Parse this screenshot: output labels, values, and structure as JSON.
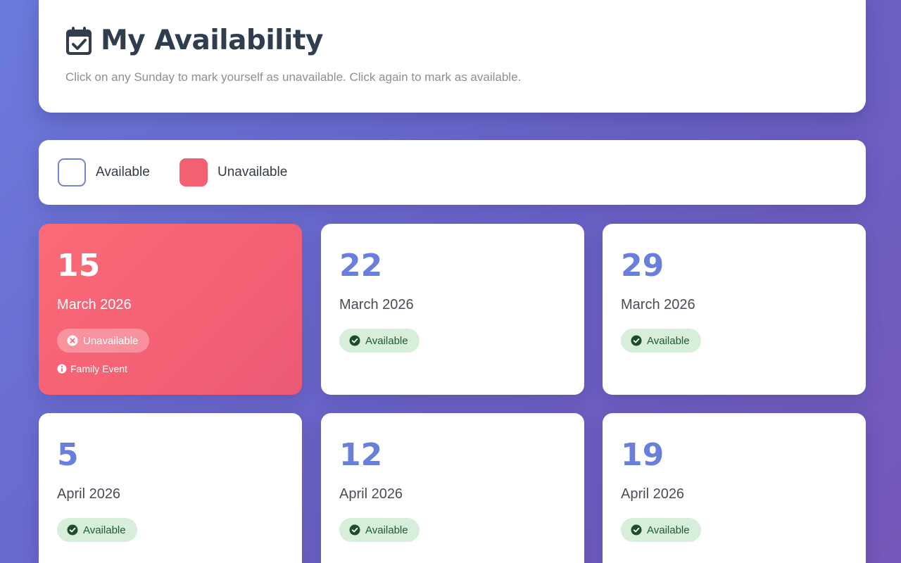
{
  "header": {
    "title": "My Availability",
    "icon": "calendar-check-icon",
    "subtitle": "Click on any Sunday to mark yourself as unavailable. Click again to mark as available."
  },
  "legend": {
    "available_label": "Available",
    "unavailable_label": "Unavailable"
  },
  "colors": {
    "unavailable": "#f26172",
    "available_accent": "#6a7fdc",
    "available_badge_bg": "#d7eedb",
    "available_badge_text": "#1f5a30",
    "title_text": "#2f3d4f"
  },
  "sundays": [
    {
      "day": "15",
      "month": "March 2026",
      "status": "Unavailable",
      "unavailable": true,
      "note": "Family Event"
    },
    {
      "day": "22",
      "month": "March 2026",
      "status": "Available",
      "unavailable": false
    },
    {
      "day": "29",
      "month": "March 2026",
      "status": "Available",
      "unavailable": false
    },
    {
      "day": "5",
      "month": "April 2026",
      "status": "Available",
      "unavailable": false
    },
    {
      "day": "12",
      "month": "April 2026",
      "status": "Available",
      "unavailable": false
    },
    {
      "day": "19",
      "month": "April 2026",
      "status": "Available",
      "unavailable": false
    }
  ]
}
